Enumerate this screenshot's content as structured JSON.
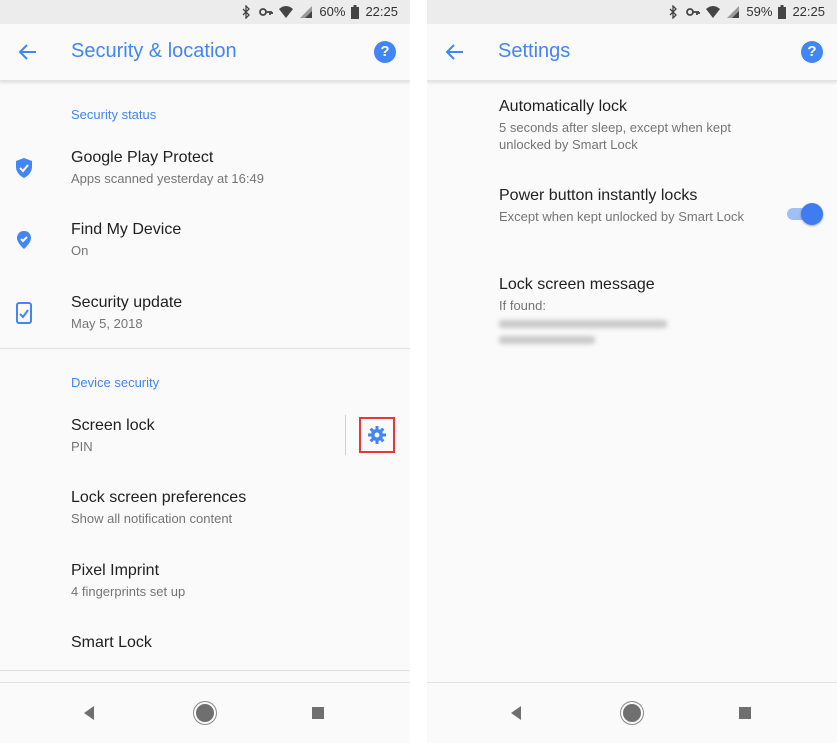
{
  "left": {
    "status": {
      "battery": "60%",
      "time": "22:25"
    },
    "appbar": {
      "title": "Security & location"
    },
    "sections": [
      {
        "header": "Security status",
        "items": [
          {
            "title": "Google Play Protect",
            "subtitle": "Apps scanned yesterday at 16:49",
            "icon": "shield-check-icon"
          },
          {
            "title": "Find My Device",
            "subtitle": "On",
            "icon": "location-pin-icon"
          },
          {
            "title": "Security update",
            "subtitle": "May 5, 2018",
            "icon": "phone-check-icon"
          }
        ]
      },
      {
        "header": "Device security",
        "items": [
          {
            "title": "Screen lock",
            "subtitle": "PIN",
            "action_icon": "gear-icon"
          },
          {
            "title": "Lock screen preferences",
            "subtitle": "Show all notification content"
          },
          {
            "title": "Pixel Imprint",
            "subtitle": "4 fingerprints set up"
          },
          {
            "title": "Smart Lock",
            "subtitle": ""
          }
        ]
      }
    ]
  },
  "right": {
    "status": {
      "battery": "59%",
      "time": "22:25"
    },
    "appbar": {
      "title": "Settings"
    },
    "items": [
      {
        "title": "Automatically lock",
        "subtitle": "5 seconds after sleep, except when kept unlocked by Smart Lock"
      },
      {
        "title": "Power button instantly locks",
        "subtitle": "Except when kept unlocked by Smart Lock",
        "toggle_on": true
      },
      {
        "title": "Lock screen message",
        "subtitle": "If found:"
      }
    ]
  },
  "colors": {
    "accent": "#4285f4",
    "highlight_box": "#e53935",
    "toggle_thumb": "#3f7cf0",
    "toggle_track": "#9fbff5"
  }
}
